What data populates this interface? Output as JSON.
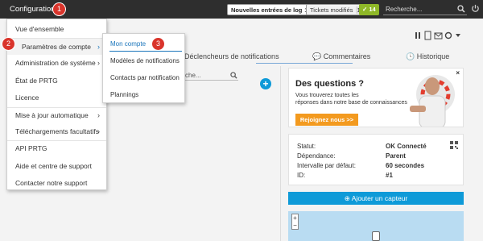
{
  "topbar": {
    "title": "Configuration",
    "step_badges": [
      "1",
      "2",
      "3"
    ],
    "log_button_label": "Nouvelles entrées de log",
    "log_count": "101",
    "tickets_label": "Tickets modifiés",
    "tickets_count": "1",
    "check_count": "14",
    "search_placeholder": "Recherche..."
  },
  "menu": {
    "items": [
      {
        "label": "Vue d'ensemble",
        "submenu": false
      },
      {
        "label": "Paramètres de compte",
        "submenu": true
      },
      {
        "label": "Administration de système",
        "submenu": true
      },
      {
        "label": "État de PRTG",
        "submenu": false
      },
      {
        "label": "Licence",
        "submenu": false
      },
      {
        "label": "Mise à jour automatique",
        "submenu": true
      },
      {
        "label": "Téléchargements facultatifs",
        "submenu": true
      },
      {
        "label": "API PRTG",
        "submenu": false
      },
      {
        "label": "Aide et centre de support",
        "submenu": false
      },
      {
        "label": "Contacter notre support",
        "submenu": false
      }
    ],
    "chevron": "›"
  },
  "submenu": {
    "items": [
      {
        "label": "Mon compte"
      },
      {
        "label": "Modèles de notifications"
      },
      {
        "label": "Contacts par notification"
      },
      {
        "label": "Plannings"
      }
    ]
  },
  "tabs": {
    "notifications": "Déclencheurs de notifications",
    "comments": "Commentaires",
    "history": "Historique"
  },
  "search_field": {
    "value": "che..."
  },
  "ad": {
    "question": "Des questions ?",
    "line1": "Vous trouverez toutes les",
    "line2": "réponses dans notre base de connaissances",
    "cta": "Rejoignez nous >>",
    "close": "×"
  },
  "status": {
    "rows": [
      {
        "label": "Statut:",
        "value": "OK  Connecté"
      },
      {
        "label": "Dépendance:",
        "value": "Parent"
      },
      {
        "label": "Intervalle par défaut:",
        "value": "60 secondes"
      },
      {
        "label": "ID:",
        "value": "#1"
      }
    ]
  },
  "add_sensor": "Ajouter un capteur",
  "map_zoom": {
    "plus": "+",
    "minus": "−"
  },
  "colors": {
    "accent_blue": "#0e9ad8",
    "badge_red": "#d9342b",
    "cta_orange": "#f39a1f",
    "check_green": "#8fb828"
  }
}
